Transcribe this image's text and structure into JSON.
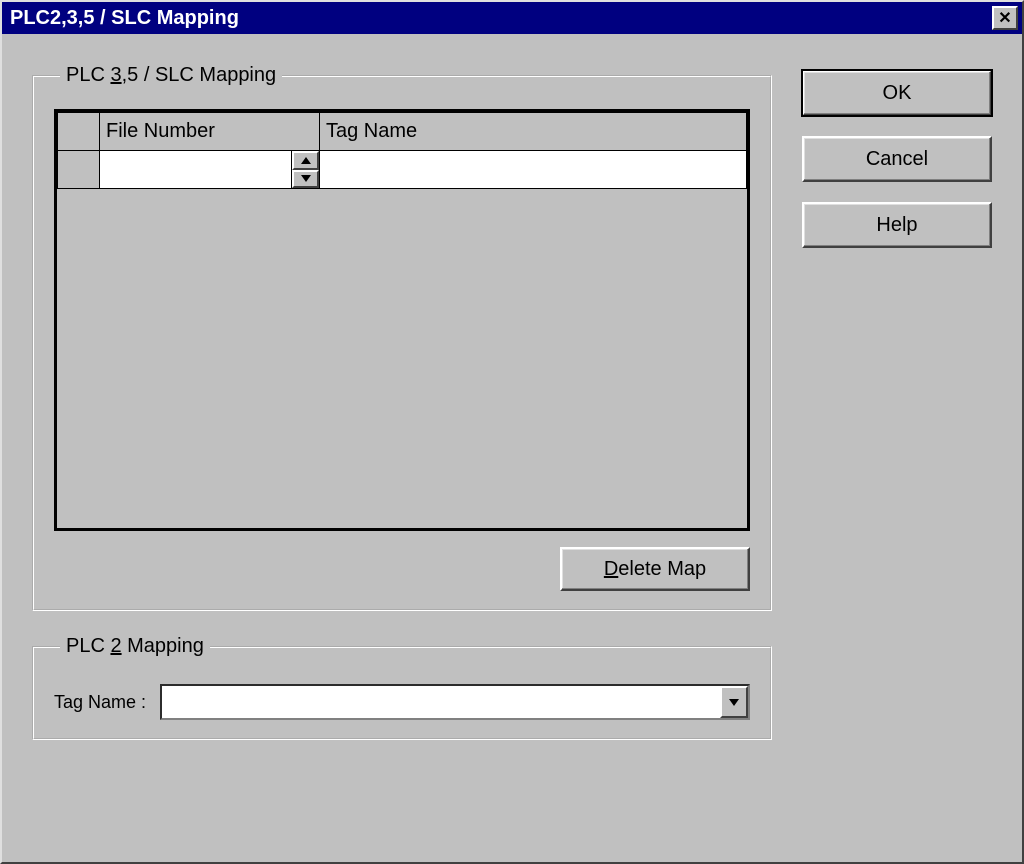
{
  "window": {
    "title": "PLC2,3,5 / SLC Mapping"
  },
  "buttons": {
    "ok": "OK",
    "cancel": "Cancel",
    "help": "Help",
    "delete_map": "elete Map"
  },
  "group1": {
    "legend_prefix": "PLC ",
    "legend_uline": "3",
    "legend_suffix": ",5 / SLC Mapping",
    "columns": {
      "file_number": "File Number",
      "tag_name": "Tag Name"
    },
    "rows": [
      {
        "file_number": "",
        "tag_name": ""
      }
    ]
  },
  "group2": {
    "legend_prefix": "PLC ",
    "legend_uline": "2",
    "legend_suffix": " Mapping",
    "tag_name_label": "Tag Name :",
    "tag_name_value": ""
  },
  "hotkeys": {
    "delete_prefix_char": "D"
  }
}
